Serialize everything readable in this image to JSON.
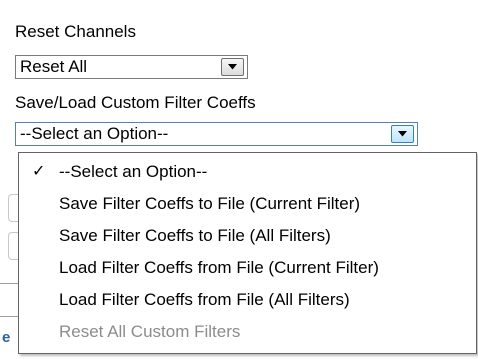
{
  "reset_channels": {
    "label": "Reset Channels",
    "selected_value": "Reset All"
  },
  "custom_filter_coeffs": {
    "label": "Save/Load Custom Filter Coeffs",
    "selected_value": "--Select an Option--",
    "menu": {
      "checked_glyph": "✓",
      "items": [
        {
          "label": "--Select an Option--",
          "checked": true,
          "enabled": true
        },
        {
          "label": "Save Filter Coeffs to File  (Current Filter)",
          "checked": false,
          "enabled": true
        },
        {
          "label": "Save Filter Coeffs to File  (All Filters)",
          "checked": false,
          "enabled": true
        },
        {
          "label": "Load Filter Coeffs from File (Current Filter)",
          "checked": false,
          "enabled": true
        },
        {
          "label": "Load Filter Coeffs from File (All Filters)",
          "checked": false,
          "enabled": true
        },
        {
          "label": "Reset All Custom Filters",
          "checked": false,
          "enabled": false
        }
      ]
    }
  },
  "background": {
    "partial_letter": "e"
  },
  "colors": {
    "disabled_text": "#8c8c8c",
    "menu_border": "#646464",
    "focus_button": "#bee6fd"
  },
  "icons": {
    "dropdown_button": "chevron-down-icon",
    "checkmark": "checkmark-icon"
  }
}
